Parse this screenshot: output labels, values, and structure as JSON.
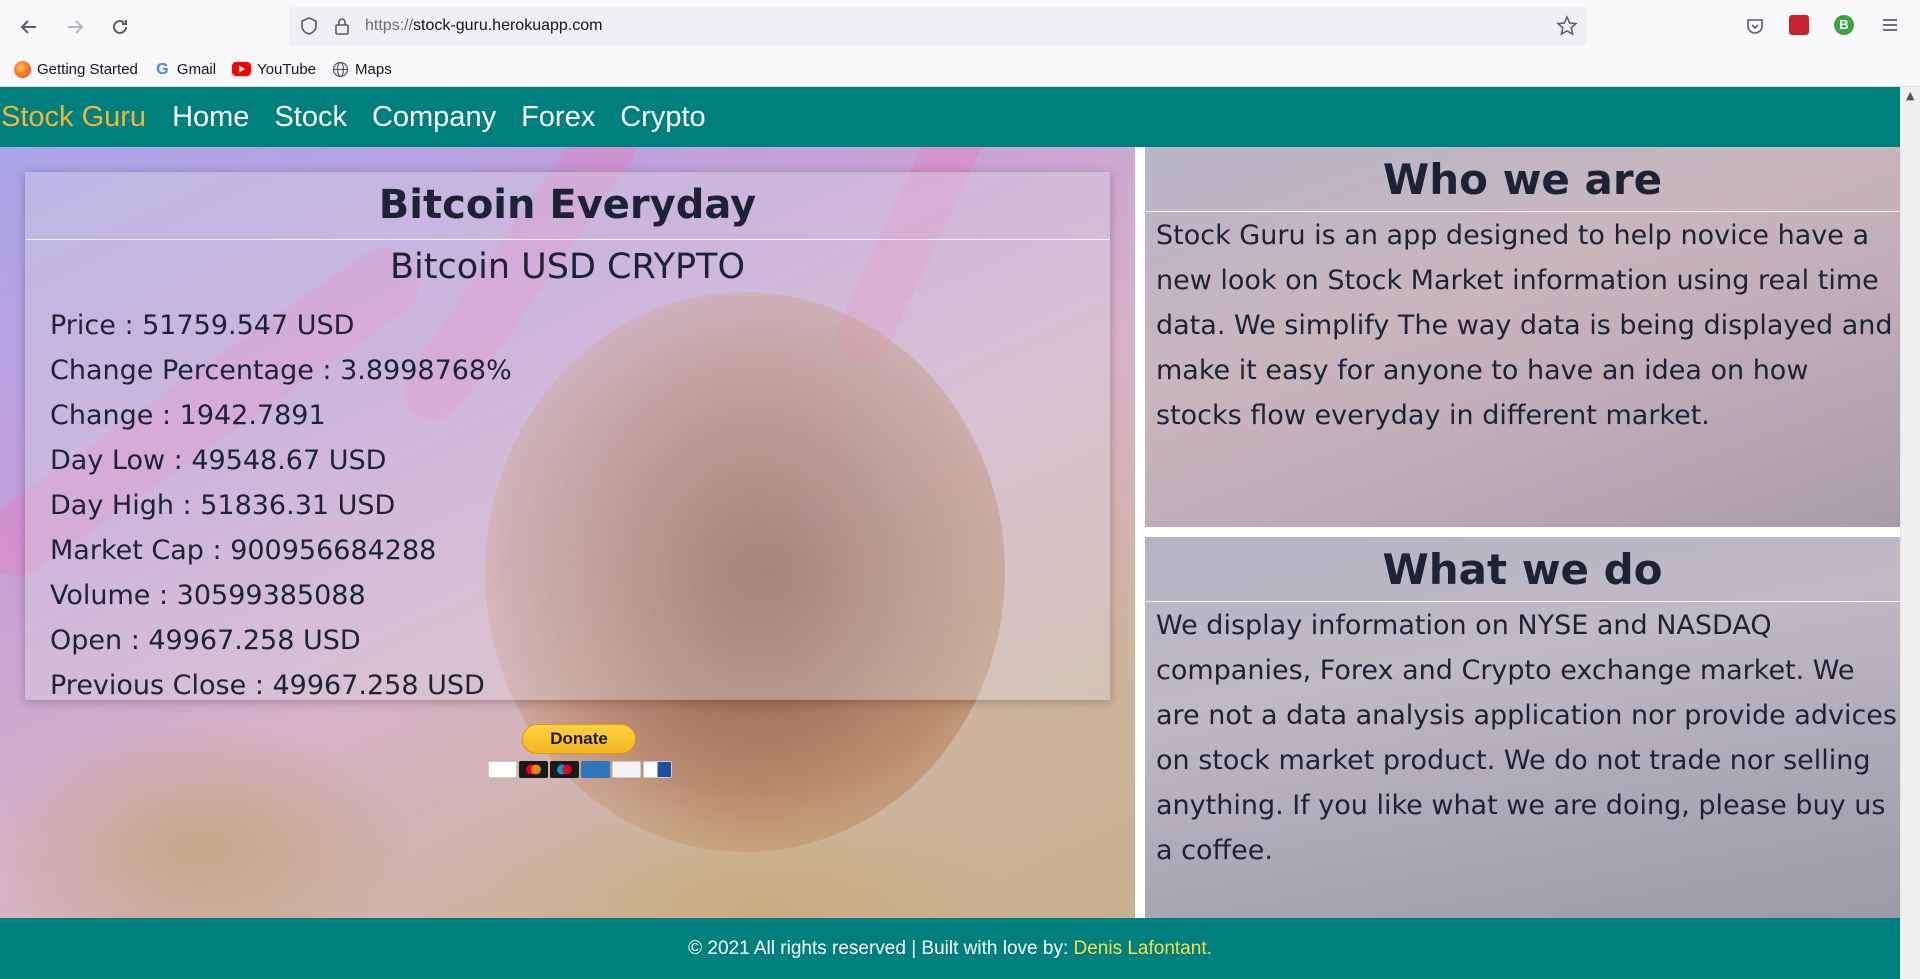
{
  "browser": {
    "url_scheme": "https://",
    "url_host": "stock-guru.herokuapp.com",
    "bookmarks": [
      {
        "label": "Getting Started",
        "icon": "firefox-icon"
      },
      {
        "label": "Gmail",
        "icon": "google-icon"
      },
      {
        "label": "YouTube",
        "icon": "youtube-icon"
      },
      {
        "label": "Maps",
        "icon": "globe-icon"
      }
    ],
    "profile_initial": "B"
  },
  "nav": {
    "brand": "Stock Guru",
    "links": [
      "Home",
      "Stock",
      "Company",
      "Forex",
      "Crypto"
    ]
  },
  "card": {
    "title": "Bitcoin Everyday",
    "subtitle": "Bitcoin USD CRYPTO",
    "rows": [
      "Price : 51759.547 USD",
      "Change Percentage : 3.8998768%",
      "Change : 1942.7891",
      "Day Low : 49548.67 USD",
      "Day High : 51836.31 USD",
      "Market Cap : 900956684288",
      "Volume : 30599385088",
      "Open : 49967.258 USD",
      "Previous Close : 49967.258 USD"
    ]
  },
  "donate": {
    "label": "Donate"
  },
  "who": {
    "title": "Who we are",
    "text": "Stock Guru is an app designed to help novice have a new look on Stock Market information using real time data. We simplify The way data is being displayed and make it easy for anyone to have an idea on how stocks flow everyday in different market."
  },
  "what": {
    "title": "What we do",
    "text": "We display information on NYSE and NASDAQ companies, Forex and Crypto exchange market. We are not a data analysis application nor provide advices on stock market product. We do not trade nor selling anything. If you like what we are doing, please buy us a coffee."
  },
  "footer": {
    "text": "© 2021 All rights reserved | Built with love by: ",
    "author": "Denis Lafontant."
  },
  "colors": {
    "nav_bg": "#007f7f",
    "brand": "#f2b43a",
    "footer_author": "#f2e24a",
    "text_dark": "#1e2235"
  }
}
